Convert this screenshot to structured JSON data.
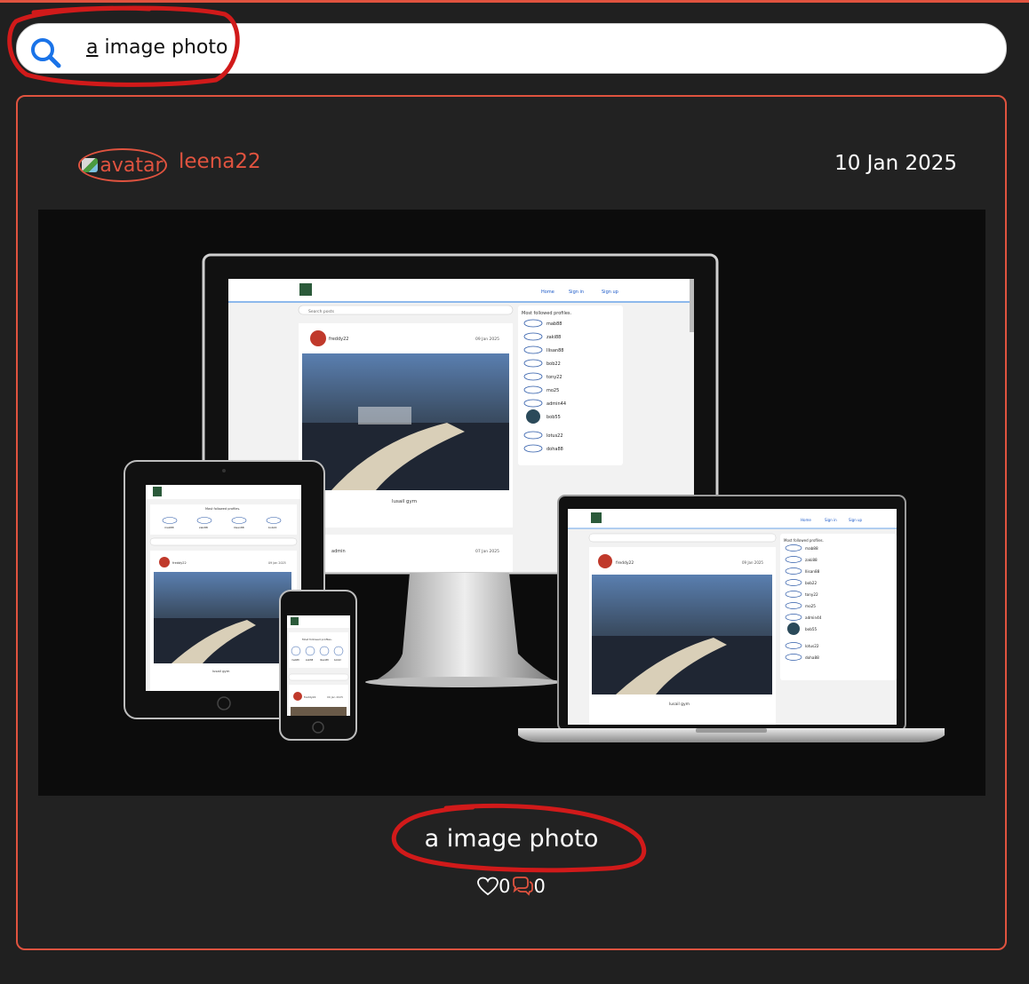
{
  "search": {
    "value_first": "a",
    "value_rest": " image photo"
  },
  "post": {
    "avatar_alt": "avatar",
    "username": "leena22",
    "date": "10 Jan 2025",
    "title": "a image photo",
    "likes": "0",
    "comments": "0"
  },
  "mockup": {
    "nav_home": "Home",
    "nav_signin": "Sign in",
    "nav_signup": "Sign up",
    "search_placeholder": "Search posts",
    "followed_heading": "Most followed profiles.",
    "profiles": [
      "mab88",
      "zaki88",
      "Ilisan88",
      "bob22",
      "tony22",
      "mo25",
      "admin44",
      "bob55",
      "lotus22",
      "doha88"
    ],
    "post_user": "freddy22",
    "post_date": "09 Jan 2025",
    "post_title": "lusail gym",
    "post2_user": "admin",
    "post2_date": "07 Jan 2025",
    "stat_zero": "0"
  },
  "colors": {
    "accent": "#e0533f",
    "annotation": "#d11a1a",
    "card_bg": "#222222",
    "page_bg": "#202020"
  }
}
